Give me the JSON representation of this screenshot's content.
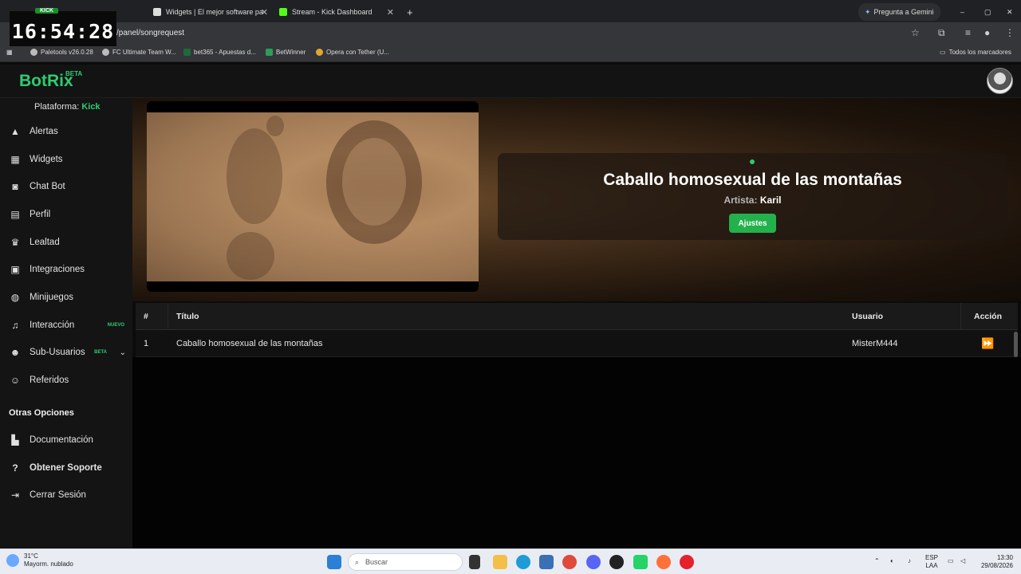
{
  "browser": {
    "tabs": [
      {
        "label": "Widgets | El mejor software pa"
      },
      {
        "label": "Stream - Kick Dashboard"
      }
    ],
    "clock": "16:54:28",
    "clock_badge": "KICK",
    "url": "/panel/songrequest",
    "gemini": "Pregunta a Gemini",
    "bookmarks": [
      "Paletools v26.0.28",
      "FC Ultimate Team W...",
      "bet365 - Apuestas d...",
      "BetWinner",
      "Opera con Tether (U..."
    ],
    "all_bookmarks": "Todos los marcadores"
  },
  "app": {
    "logo": "BotRix",
    "logo_badge": "BETA"
  },
  "sidebar": {
    "platform_label": "Plataforma:",
    "platform_value": "Kick",
    "items": [
      {
        "label": "Alertas",
        "icon": "warning-icon"
      },
      {
        "label": "Widgets",
        "icon": "grid-icon"
      },
      {
        "label": "Chat Bot",
        "icon": "robot-icon"
      },
      {
        "label": "Perfil",
        "icon": "id-card-icon"
      },
      {
        "label": "Lealtad",
        "icon": "trophy-icon"
      },
      {
        "label": "Integraciones",
        "icon": "integration-icon"
      },
      {
        "label": "Minijuegos",
        "icon": "gamepad-icon"
      },
      {
        "label": "Interacción",
        "icon": "music-icon",
        "tag": "NUEVO"
      },
      {
        "label": "Sub-Usuarios",
        "icon": "users-icon",
        "tag": "BETA"
      },
      {
        "label": "Referidos",
        "icon": "user-group-icon"
      }
    ],
    "section_other": "Otras Opciones",
    "other_items": [
      {
        "label": "Documentación",
        "icon": "book-icon"
      },
      {
        "label": "Obtener Soporte",
        "icon": "help-icon"
      },
      {
        "label": "Cerrar Sesión",
        "icon": "logout-icon"
      }
    ]
  },
  "now_playing": {
    "title": "Caballo homosexual de las montañas",
    "artist_label": "Artista:",
    "artist": "Karil",
    "settings_button": "Ajustes"
  },
  "queue": {
    "headers": [
      "#",
      "Título",
      "Usuario",
      "Acción"
    ],
    "rows": [
      {
        "num": "1",
        "title": "Caballo homosexual de las montañas",
        "user": "MisterM444"
      }
    ]
  },
  "taskbar": {
    "temp": "31°C",
    "weather": "Mayorm. nublado",
    "search": "Buscar",
    "lang1": "ESP",
    "lang2": "LAA",
    "time": "13:30",
    "date": "29/08/2026"
  }
}
